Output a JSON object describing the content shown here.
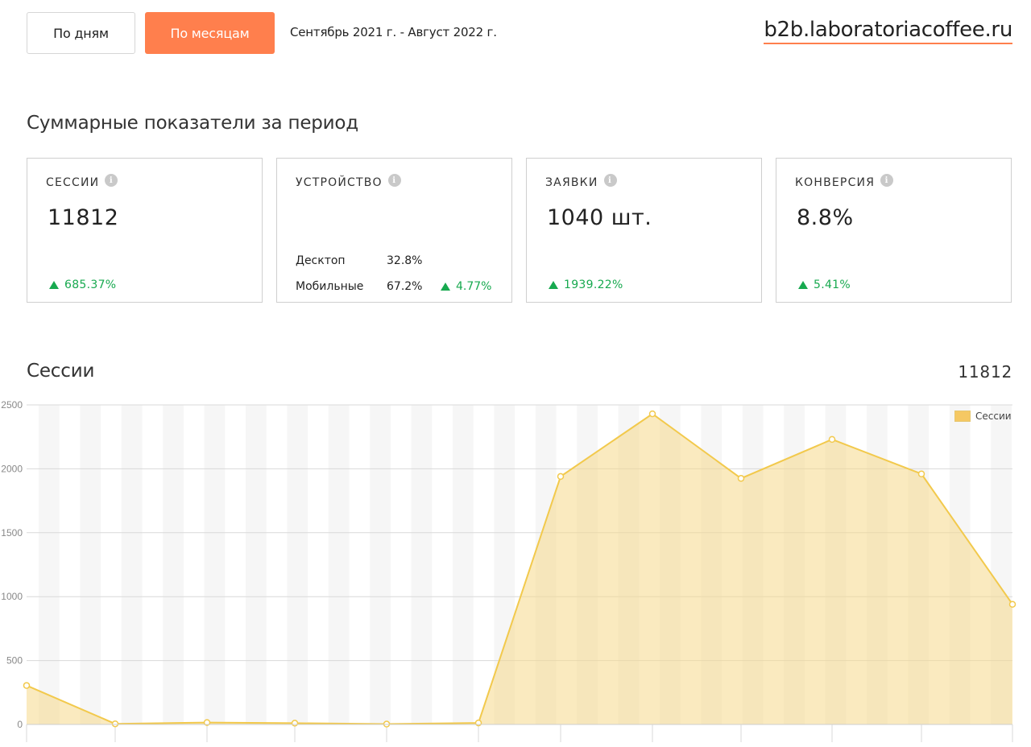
{
  "toolbar": {
    "by_days": "По дням",
    "by_months": "По месяцам",
    "period": "Сентябрь 2021 г. - Август 2022 г."
  },
  "site": "b2b.laboratoriacoffee.ru",
  "summary": {
    "title": "Суммарные показатели за период",
    "cards": [
      {
        "title": "СЕССИИ",
        "value": "11812",
        "delta": "685.37%"
      },
      {
        "title": "УСТРОЙСТВО",
        "rows": [
          {
            "label": "Десктоп",
            "value": "32.8%",
            "delta": ""
          },
          {
            "label": "Мобильные",
            "value": "67.2%",
            "delta": "4.77%"
          }
        ]
      },
      {
        "title": "ЗАЯВКИ",
        "value": "1040 шт.",
        "delta": "1939.22%"
      },
      {
        "title": "КОНВЕРСИЯ",
        "value": "8.8%",
        "delta": "5.41%"
      }
    ]
  },
  "sessions_chart": {
    "title": "Сессии",
    "total": "11812"
  },
  "colors": {
    "accent": "#ff7f4d",
    "positive": "#17a94f",
    "series_line": "#f2c94c",
    "series_fill": "#f5d98a"
  },
  "chart_data": {
    "type": "area",
    "x": [
      0,
      1,
      2,
      3,
      4,
      5,
      6,
      7,
      8,
      9,
      10,
      11
    ],
    "series": [
      {
        "name": "Сессии",
        "values": [
          305,
          5,
          15,
          10,
          3,
          12,
          1940,
          2430,
          1925,
          2230,
          1960,
          940
        ]
      }
    ],
    "ylim": [
      0,
      2500
    ],
    "yticks": [
      0,
      500,
      1000,
      1500,
      2000,
      2500
    ],
    "grid": true,
    "legend": "top-right"
  }
}
